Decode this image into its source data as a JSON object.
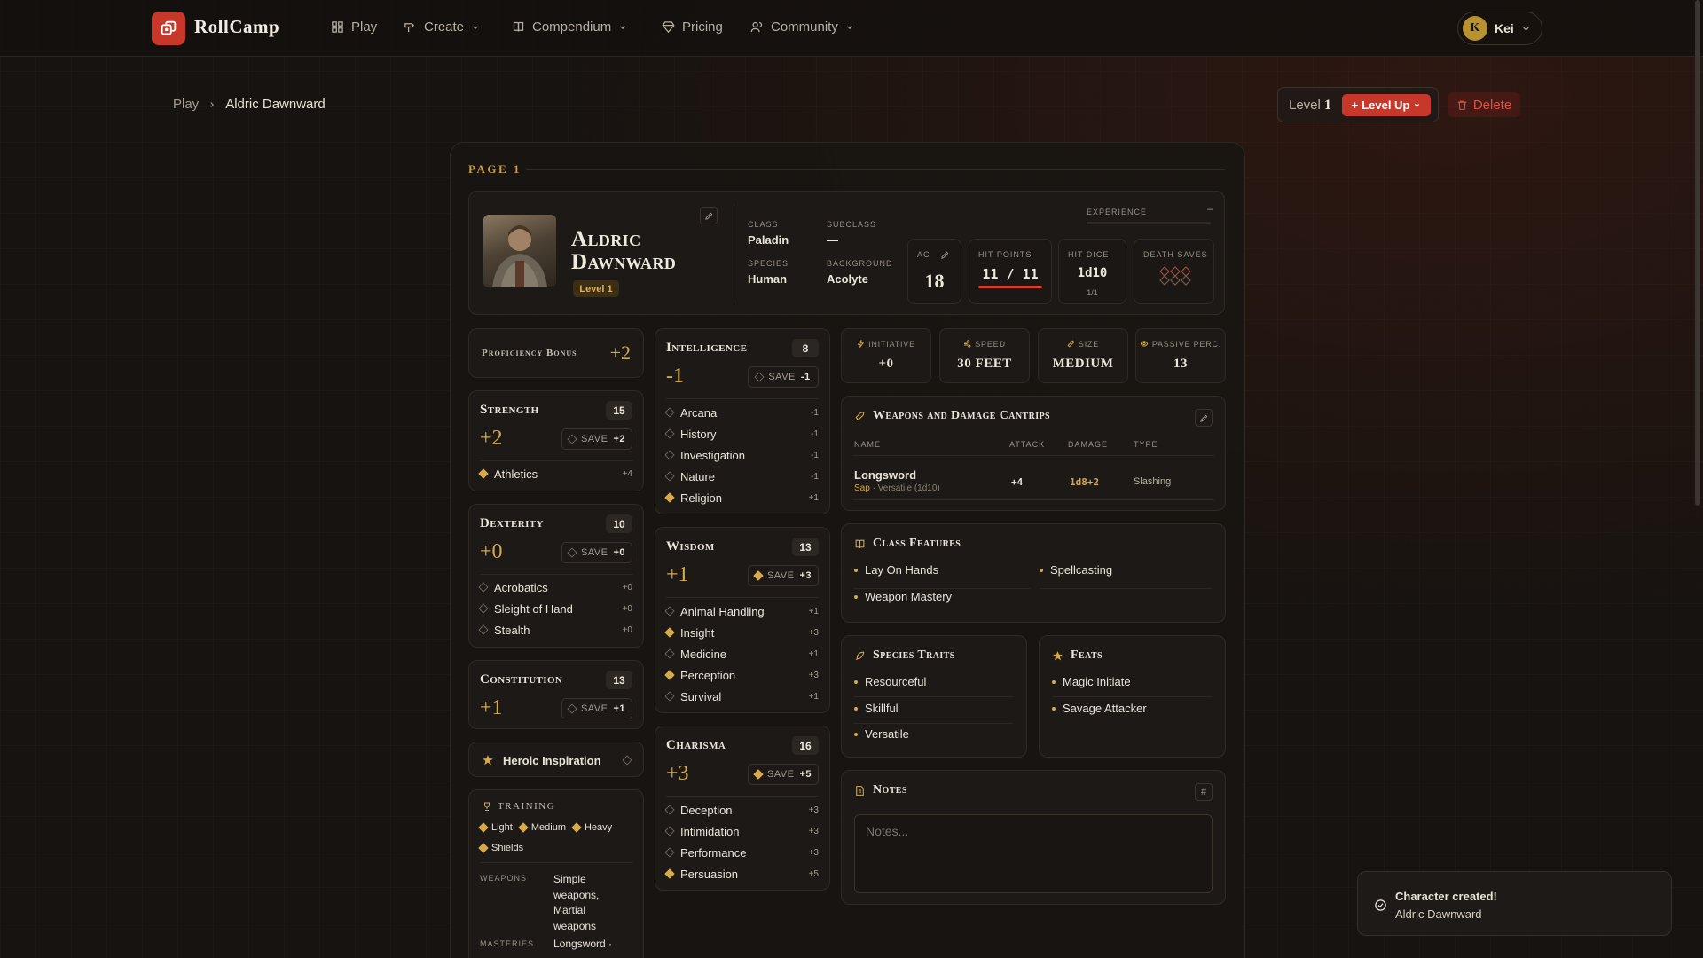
{
  "nav": {
    "brand": "RollCamp",
    "items": [
      "Play",
      "Create",
      "Compendium",
      "Pricing",
      "Community"
    ],
    "user_initial": "K",
    "user_name": "Kei"
  },
  "breadcrumb": {
    "root": "Play",
    "current": "Aldric Dawnward"
  },
  "actions": {
    "level_label": "Level",
    "level_value": "1",
    "level_up": "Level Up",
    "delete": "Delete"
  },
  "page_label": "PAGE 1",
  "character": {
    "name_line1": "Aldric",
    "name_line2": "Dawnward",
    "level_badge": "Level 1",
    "class_label": "CLASS",
    "class": "Paladin",
    "subclass_label": "SUBCLASS",
    "subclass": "—",
    "species_label": "SPECIES",
    "species": "Human",
    "background_label": "BACKGROUND",
    "background": "Acolyte",
    "experience_label": "EXPERIENCE",
    "experience": "–",
    "ac_label": "AC",
    "ac": "18",
    "hp_label": "HIT POINTS",
    "hp": "11 / 11",
    "hp_fraction": 1.0,
    "hit_dice_label": "HIT DICE",
    "hit_dice": "1d10",
    "hit_dice_count": "1/1",
    "death_saves_label": "DEATH SAVES"
  },
  "proficiency": {
    "label": "Proficiency Bonus",
    "value": "+2"
  },
  "abilities": {
    "strength": {
      "name": "Strength",
      "score": "15",
      "mod": "+2",
      "save_label": "SAVE",
      "save": "+2",
      "skills": [
        {
          "name": "Athletics",
          "val": "+4",
          "prof": true
        }
      ]
    },
    "dexterity": {
      "name": "Dexterity",
      "score": "10",
      "mod": "+0",
      "save_label": "SAVE",
      "save": "+0",
      "skills": [
        {
          "name": "Acrobatics",
          "val": "+0"
        },
        {
          "name": "Sleight of Hand",
          "val": "+0"
        },
        {
          "name": "Stealth",
          "val": "+0"
        }
      ]
    },
    "constitution": {
      "name": "Constitution",
      "score": "13",
      "mod": "+1",
      "save_label": "SAVE",
      "save": "+1"
    },
    "intelligence": {
      "name": "Intelligence",
      "score": "8",
      "mod": "-1",
      "save_label": "SAVE",
      "save": "-1",
      "skills": [
        {
          "name": "Arcana",
          "val": "-1"
        },
        {
          "name": "History",
          "val": "-1"
        },
        {
          "name": "Investigation",
          "val": "-1"
        },
        {
          "name": "Nature",
          "val": "-1"
        },
        {
          "name": "Religion",
          "val": "+1",
          "prof": true
        }
      ]
    },
    "wisdom": {
      "name": "Wisdom",
      "score": "13",
      "mod": "+1",
      "save_label": "SAVE",
      "save": "+3",
      "skills": [
        {
          "name": "Animal Handling",
          "val": "+1"
        },
        {
          "name": "Insight",
          "val": "+3",
          "prof": true
        },
        {
          "name": "Medicine",
          "val": "+1"
        },
        {
          "name": "Perception",
          "val": "+3",
          "prof": true
        },
        {
          "name": "Survival",
          "val": "+1"
        }
      ]
    },
    "charisma": {
      "name": "Charisma",
      "score": "16",
      "mod": "+3",
      "save_label": "SAVE",
      "save": "+5",
      "skills": [
        {
          "name": "Deception",
          "val": "+3"
        },
        {
          "name": "Intimidation",
          "val": "+3"
        },
        {
          "name": "Performance",
          "val": "+3"
        },
        {
          "name": "Persuasion",
          "val": "+5",
          "prof": true
        }
      ]
    }
  },
  "heroic_inspiration": "Heroic Inspiration",
  "training": {
    "title": "TRAINING",
    "armor": [
      "Light",
      "Medium",
      "Heavy",
      "Shields"
    ],
    "weapons_label": "WEAPONS",
    "weapons": [
      "Simple",
      "weapons,",
      "Martial",
      "weapons"
    ],
    "masteries_label": "MASTERIES",
    "masteries": "Longsword ·"
  },
  "quick_stats": [
    {
      "label": "INITIATIVE",
      "value": "+0"
    },
    {
      "label": "SPEED",
      "value": "30 FEET"
    },
    {
      "label": "SIZE",
      "value": "MEDIUM"
    },
    {
      "label": "PASSIVE PERC.",
      "value": "13"
    }
  ],
  "weapons": {
    "title": "Weapons and Damage Cantrips",
    "headers": [
      "NAME",
      "ATTACK",
      "DAMAGE",
      "TYPE"
    ],
    "rows": [
      {
        "name": "Longsword",
        "mastery": "Sap",
        "props": "· Versatile (1d10)",
        "attack": "+4",
        "damage": "1d8+2",
        "type": "Slashing"
      }
    ]
  },
  "class_features": {
    "title": "Class Features",
    "items": [
      "Lay On Hands",
      "Spellcasting",
      "Weapon Mastery"
    ]
  },
  "species_traits": {
    "title": "Species Traits",
    "items": [
      "Resourceful",
      "Skillful",
      "Versatile"
    ]
  },
  "feats": {
    "title": "Feats",
    "items": [
      "Magic Initiate",
      "Savage Attacker"
    ]
  },
  "notes": {
    "title": "Notes",
    "placeholder": "Notes..."
  },
  "toast": {
    "title": "Character created!",
    "body": "Aldric Dawnward"
  },
  "colors": {
    "accent": "#c8382a",
    "gold": "#d6a94a",
    "bg": "#161310"
  }
}
